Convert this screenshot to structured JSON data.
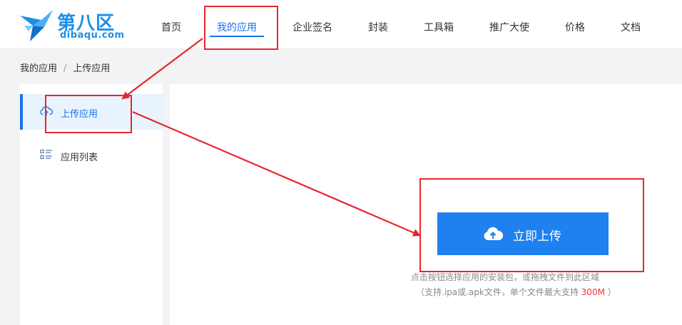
{
  "brand": {
    "name_cn": "第八区",
    "domain": "dibaqu.com",
    "color": "#1a8fe8"
  },
  "nav": {
    "items": [
      {
        "label": "首页"
      },
      {
        "label": "我的应用",
        "active": true
      },
      {
        "label": "企业签名"
      },
      {
        "label": "封装"
      },
      {
        "label": "工具箱"
      },
      {
        "label": "推广大使"
      },
      {
        "label": "价格"
      },
      {
        "label": "文档"
      }
    ]
  },
  "breadcrumb": {
    "root": "我的应用",
    "separator": "/",
    "current": "上传应用"
  },
  "sidebar": {
    "items": [
      {
        "label": "上传应用",
        "icon": "cloud-upload-icon",
        "active": true
      },
      {
        "label": "应用列表",
        "icon": "list-icon",
        "active": false
      }
    ]
  },
  "upload": {
    "button_label": "立即上传",
    "hint_line1": "点击按钮选择应用的安装包，或拖拽文件到此区域",
    "hint_line2_prefix": "（支持.ipa或.apk文件，单个文件最大支持 ",
    "hint_size": "300M",
    "hint_line2_suffix": " ）"
  },
  "colors": {
    "accent": "#1a73e8",
    "button": "#1f80f0",
    "annotation": "#e8262d",
    "highlight": "#ee3333"
  }
}
